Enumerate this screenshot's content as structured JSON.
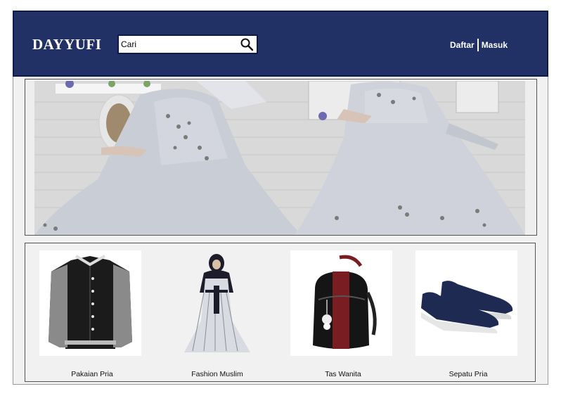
{
  "header": {
    "brand": "DAYYUFI",
    "search": {
      "value": "Cari",
      "icon": "search-icon"
    },
    "auth": {
      "register_label": "Daftar",
      "login_label": "Masuk"
    }
  },
  "categories": [
    {
      "label": "Pakaian Pria",
      "icon": "jacket-image"
    },
    {
      "label": "Fashion Muslim",
      "icon": "dress-image"
    },
    {
      "label": "Tas Wanita",
      "icon": "backpack-image"
    },
    {
      "label": "Sepatu Pria",
      "icon": "shoes-image"
    }
  ],
  "colors": {
    "header_bg": "#223165",
    "header_border": "#0e1a4a",
    "page_bg": "#f1f1f1"
  }
}
